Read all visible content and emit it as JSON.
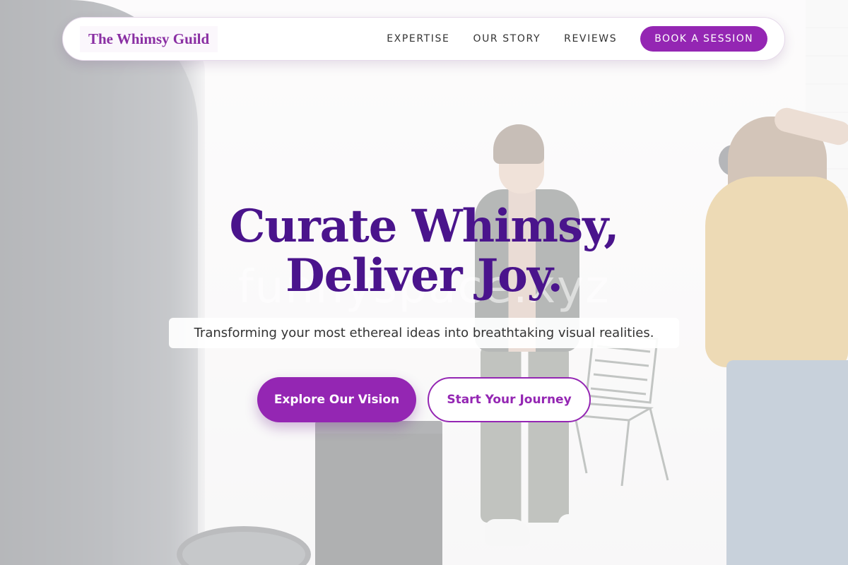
{
  "header": {
    "brand": "The Whimsy Guild",
    "nav_links": [
      "EXPERTISE",
      "OUR STORY",
      "REVIEWS"
    ],
    "cta_label": "BOOK A SESSION"
  },
  "hero": {
    "title_line1": "Curate Whimsy,",
    "title_line2": "Deliver Joy.",
    "watermark": "funnyspace.xyz",
    "subtitle": "Transforming your most ethereal ideas into breathtaking visual realities.",
    "primary_button": "Explore Our Vision",
    "secondary_button": "Start Your Journey"
  },
  "colors": {
    "accent": "#9426b3",
    "title": "#4a148c",
    "brand": "#8a2fa3"
  },
  "background": {
    "description_icon": "photo-studio-scene"
  }
}
